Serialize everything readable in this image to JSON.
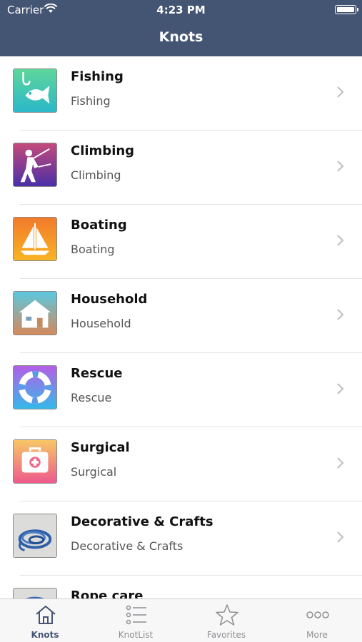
{
  "status_bar": {
    "carrier": "Carrier",
    "time": "4:23 PM"
  },
  "nav": {
    "title": "Knots"
  },
  "categories": [
    {
      "title": "Fishing",
      "subtitle": "Fishing",
      "icon": "fishing-icon"
    },
    {
      "title": "Climbing",
      "subtitle": "Climbing",
      "icon": "climbing-icon"
    },
    {
      "title": "Boating",
      "subtitle": "Boating",
      "icon": "boating-icon"
    },
    {
      "title": "Household",
      "subtitle": "Household",
      "icon": "household-icon"
    },
    {
      "title": "Rescue",
      "subtitle": "Rescue",
      "icon": "rescue-icon"
    },
    {
      "title": "Surgical",
      "subtitle": "Surgical",
      "icon": "surgical-icon"
    },
    {
      "title": "Decorative & Crafts",
      "subtitle": "Decorative & Crafts",
      "icon": "decorative-rope-icon"
    },
    {
      "title": "Rope care",
      "subtitle": "",
      "icon": "rope-care-icon"
    }
  ],
  "tabs": [
    {
      "label": "Knots",
      "icon": "house-icon",
      "active": true
    },
    {
      "label": "KnotList",
      "icon": "list-icon",
      "active": false
    },
    {
      "label": "Favorites",
      "icon": "star-icon",
      "active": false
    },
    {
      "label": "More",
      "icon": "more-dots-icon",
      "active": false
    }
  ],
  "colors": {
    "header": "#445573",
    "active_tab": "#445573",
    "inactive_tab": "#8e8e93"
  }
}
